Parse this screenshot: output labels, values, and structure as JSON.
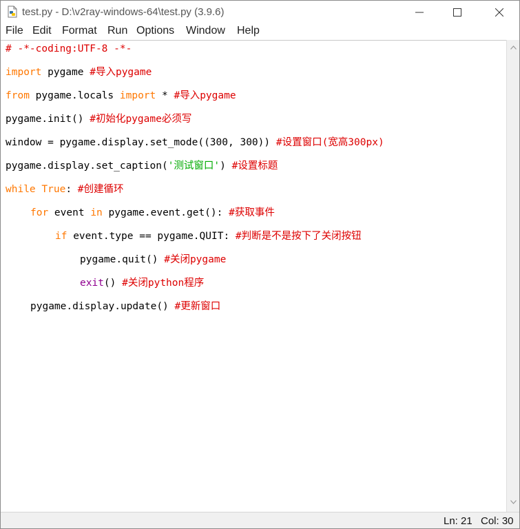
{
  "window": {
    "title": "test.py - D:\\v2ray-windows-64\\test.py (3.9.6)",
    "icon": "python-file-icon"
  },
  "menu": [
    "File",
    "Edit",
    "Format",
    "Run",
    "Options",
    "Window",
    "Help"
  ],
  "code": {
    "line1": "# -*-coding:UTF-8 -*-",
    "line2": {
      "kw": "import",
      "plain": " pygame ",
      "cm": "#导入pygame"
    },
    "line3": {
      "kw1": "from",
      "plain1": " pygame.locals ",
      "kw2": "import",
      "plain2": " * ",
      "cm": "#导入pygame"
    },
    "line4": {
      "plain": "pygame.init() ",
      "cm": "#初始化pygame必须写"
    },
    "line5": {
      "plain": "window = pygame.display.set_mode((300, 300)) ",
      "cm": "#设置窗口(宽高300px)"
    },
    "line6": {
      "plain1": "pygame.display.set_caption(",
      "st": "'测试窗口'",
      "plain2": ") ",
      "cm": "#设置标题"
    },
    "line7": {
      "kw1": "while",
      "plain1": " ",
      "kw2": "True",
      "plain2": ": ",
      "cm": "#创建循环"
    },
    "line8": {
      "kw1": "for",
      "plain1": " event ",
      "kw2": "in",
      "plain2": " pygame.event.get(): ",
      "cm": "#获取事件"
    },
    "line9": {
      "kw": "if",
      "plain": " event.type == pygame.QUIT: ",
      "cm": "#判断是不是按下了关闭按钮"
    },
    "line10": {
      "plain": "pygame.quit() ",
      "cm": "#关闭pygame"
    },
    "line11": {
      "bi": "exit",
      "plain": "() ",
      "cm": "#关闭python程序"
    },
    "line12": {
      "plain": "pygame.display.update() ",
      "cm": "#更新窗口"
    }
  },
  "status": {
    "line": "Ln: 21",
    "col": "Col: 30"
  },
  "colors": {
    "keyword": "#ff7700",
    "comment": "#dd0000",
    "builtin": "#900090",
    "string": "#00aa00"
  }
}
